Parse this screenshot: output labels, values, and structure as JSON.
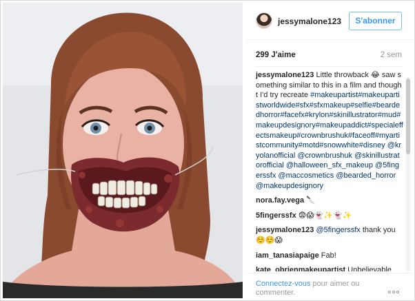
{
  "post": {
    "username": "jessymalone123",
    "follow_label": "S'abonner",
    "likes": "299 J'aime",
    "time_ago": "2 sem"
  },
  "comments": [
    {
      "author": "jessymalone123",
      "parts": [
        {
          "t": "text",
          "v": " Little throwback 😂 saw something similar to this in a film and thought I'd try recreate "
        },
        {
          "t": "link",
          "v": "#makeupartist#makeupartistworldwide#sfx#sfxmakeup#selfie#beardedhorror#facefx#krylon#skinillustrator#mud#makeupdesignory#makeupaddict#specialeffectsmakeup#crownbrushuk#faceoff#myartistcommunity#motd#snowwhite#disney"
        },
        {
          "t": "text",
          "v": " "
        },
        {
          "t": "link",
          "v": "@kryolanofficial"
        },
        {
          "t": "text",
          "v": " "
        },
        {
          "t": "link",
          "v": "@crownbrushuk"
        },
        {
          "t": "text",
          "v": " "
        },
        {
          "t": "link",
          "v": "@skinillustratorofficial"
        },
        {
          "t": "text",
          "v": " "
        },
        {
          "t": "link",
          "v": "@halloween_sfx_makeup"
        },
        {
          "t": "text",
          "v": " "
        },
        {
          "t": "link",
          "v": "@5fingerssfx"
        },
        {
          "t": "text",
          "v": " "
        },
        {
          "t": "link",
          "v": "@maccosmetics"
        },
        {
          "t": "text",
          "v": " "
        },
        {
          "t": "link",
          "v": "@bearded_horror"
        },
        {
          "t": "text",
          "v": " "
        },
        {
          "t": "link",
          "v": "@makeupdesignory"
        }
      ]
    },
    {
      "author": "nora.fay.vega",
      "parts": [
        {
          "t": "text",
          "v": " 🔪"
        }
      ]
    },
    {
      "author": "5fingerssfx",
      "parts": [
        {
          "t": "text",
          "v": " 😨😱👻✨👻✨"
        }
      ]
    },
    {
      "author": "jessymalone123",
      "parts": [
        {
          "t": "link",
          "v": " @5fingerssfx"
        },
        {
          "t": "text",
          "v": " thank you ☺️☺️😱"
        }
      ]
    },
    {
      "author": "iam_tanasiapaige",
      "parts": [
        {
          "t": "text",
          "v": " Fab!"
        }
      ]
    },
    {
      "author": "kate_obrienmakeupartist",
      "parts": [
        {
          "t": "text",
          "v": " Unbelievable"
        }
      ]
    }
  ],
  "footer": {
    "login_link": "Connectez-vous",
    "login_rest": " pour aimer ou commenter."
  },
  "icons": {
    "more": "more-options-icon"
  }
}
